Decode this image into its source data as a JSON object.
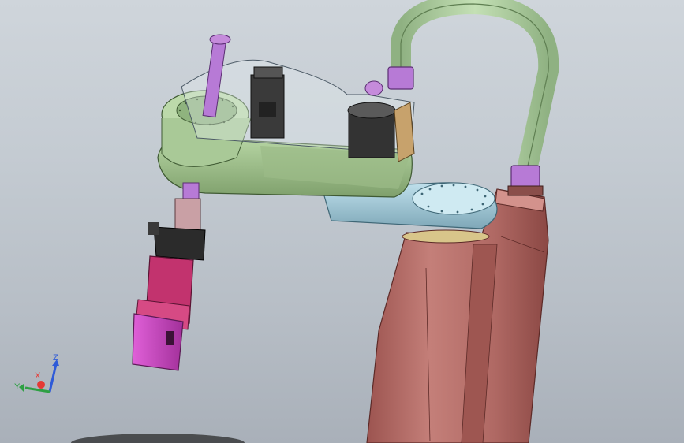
{
  "triad": {
    "x_label": "X",
    "y_label": "Y",
    "z_label": "Z"
  },
  "colors": {
    "background_top": "#cfd5db",
    "background_bottom": "#a9b0b9",
    "cable": "#a9c99a",
    "collar": "#b77ad6",
    "arm1": "#9dbf8a",
    "arm2": "#9ec4d2",
    "base": "#b8706b",
    "gripper": "#d048c4",
    "gripper_body": "#c2336e",
    "motor": "#3b3b3b",
    "axis_x": "#e53935",
    "axis_y": "#2ea043",
    "axis_z": "#2f5bd8"
  }
}
